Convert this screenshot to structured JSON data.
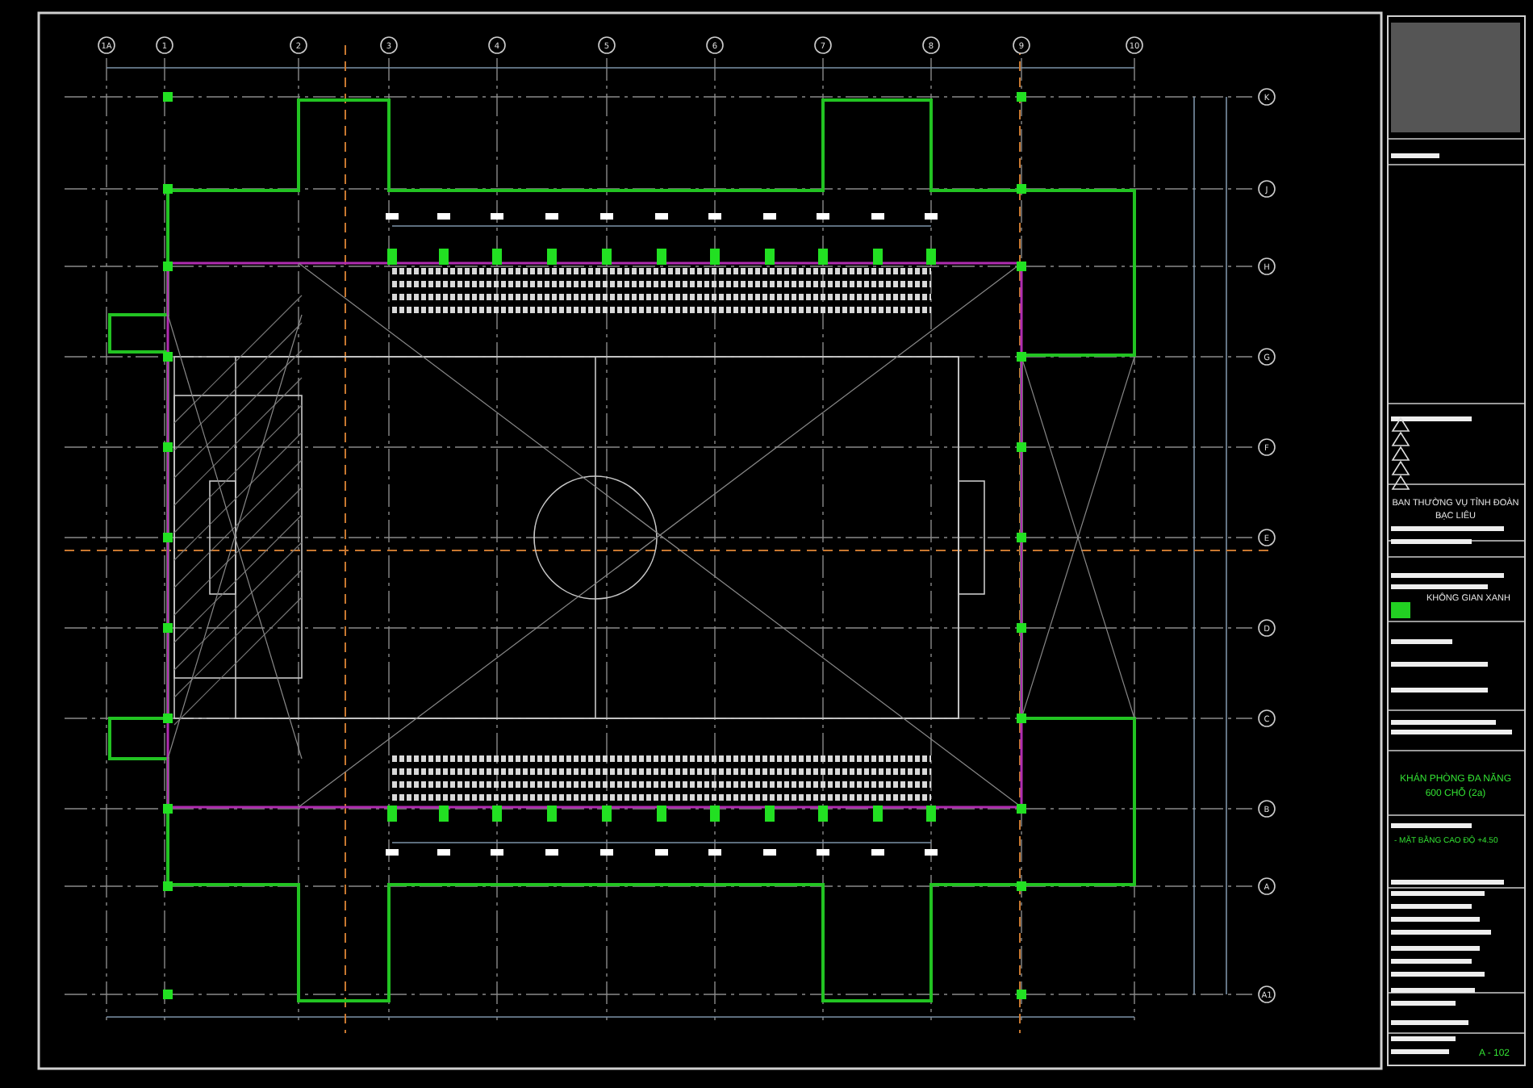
{
  "drawing": {
    "column_axes": [
      "1A",
      "1",
      "2",
      "3",
      "4",
      "5",
      "6",
      "7",
      "8",
      "9",
      "10"
    ],
    "row_axes": [
      "K",
      "J",
      "H",
      "G",
      "F",
      "E",
      "D",
      "C",
      "B",
      "A",
      "A1"
    ]
  },
  "title_block": {
    "client": "BAN THƯỜNG VỤ TỈNH ĐOÀN",
    "client_line2": "BẠC LIÊU",
    "company": "KHÔNG GIAN XANH",
    "project": "KHÁN PHÒNG ĐA NĂNG",
    "project_line2": "600 CHỖ (2a)",
    "sheet_title": "- MẶT BẰNG CAO ĐỘ +4.50",
    "sheet_number": "A - 102"
  }
}
